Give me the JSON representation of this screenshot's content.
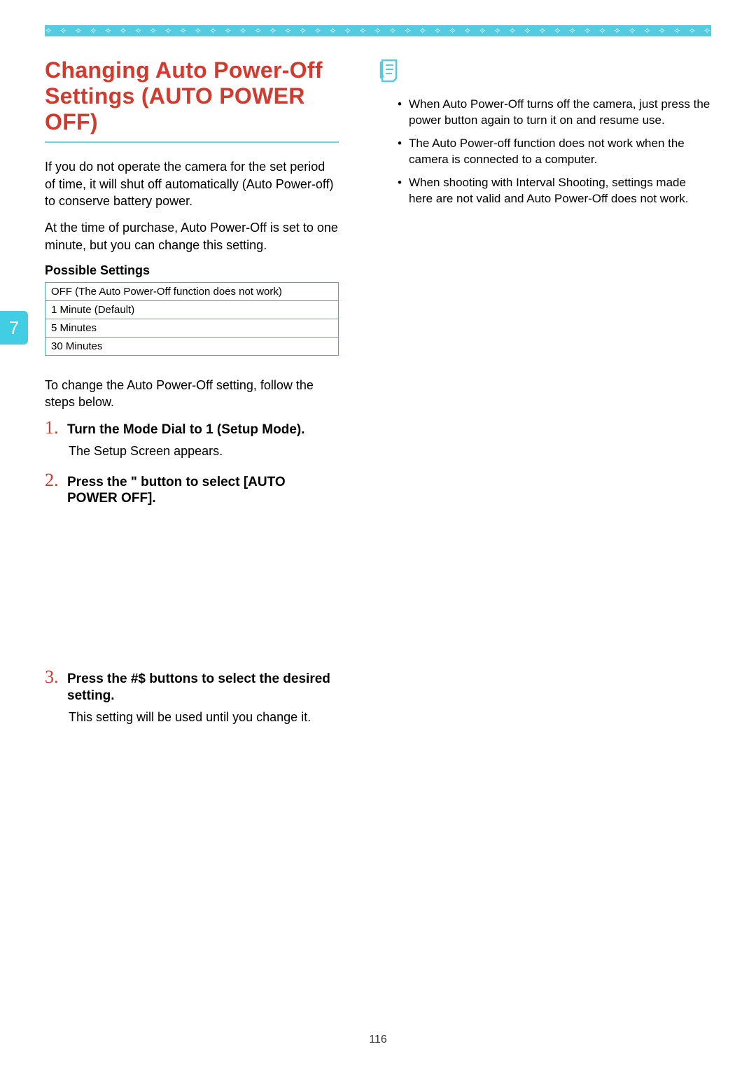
{
  "border_pattern": "✧ ✧ ✧ ✧ ✧ ✧ ✧ ✧ ✧ ✧ ✧ ✧ ✧ ✧ ✧ ✧ ✧ ✧ ✧ ✧ ✧ ✧ ✧ ✧ ✧ ✧ ✧ ✧ ✧ ✧ ✧ ✧ ✧ ✧ ✧ ✧ ✧ ✧ ✧ ✧ ✧ ✧ ✧ ✧ ✧ ✧ ✧ ✧ ✧ ✧ ✧ ✧ ✧",
  "chapter_number": "7",
  "title": "Changing Auto Power-Off Settings (AUTO POWER OFF)",
  "intro_p1": "If you do not operate the camera for the set period of time, it will shut off automatically (Auto Power-off) to conserve battery power.",
  "intro_p2": "At the time of purchase, Auto Power-Off is set to one minute, but you can change this setting.",
  "possible_settings_label": "Possible Settings",
  "settings_rows": [
    "OFF (The Auto Power-Off function does not work)",
    "1 Minute (Default)",
    "5 Minutes",
    "30 Minutes"
  ],
  "steps_intro": "To change the Auto Power-Off setting, follow the steps below.",
  "steps": [
    {
      "num": "1.",
      "title": "Turn the Mode Dial to 1 (Setup Mode).",
      "body": "The Setup Screen appears."
    },
    {
      "num": "2.",
      "title": "Press the \"   button to select [AUTO POWER OFF].",
      "body": ""
    },
    {
      "num": "3.",
      "title": "Press the #$   buttons to select the desired setting.",
      "body": "This setting will be used until you change it."
    }
  ],
  "notes": [
    "When Auto Power-Off turns off the camera, just press the power button again to turn it on and resume use.",
    "The Auto Power-off function does not work when the camera is connected to a computer.",
    "When shooting with Interval Shooting, settings made here are not valid and Auto Power-Off does not work."
  ],
  "page_number": "116"
}
